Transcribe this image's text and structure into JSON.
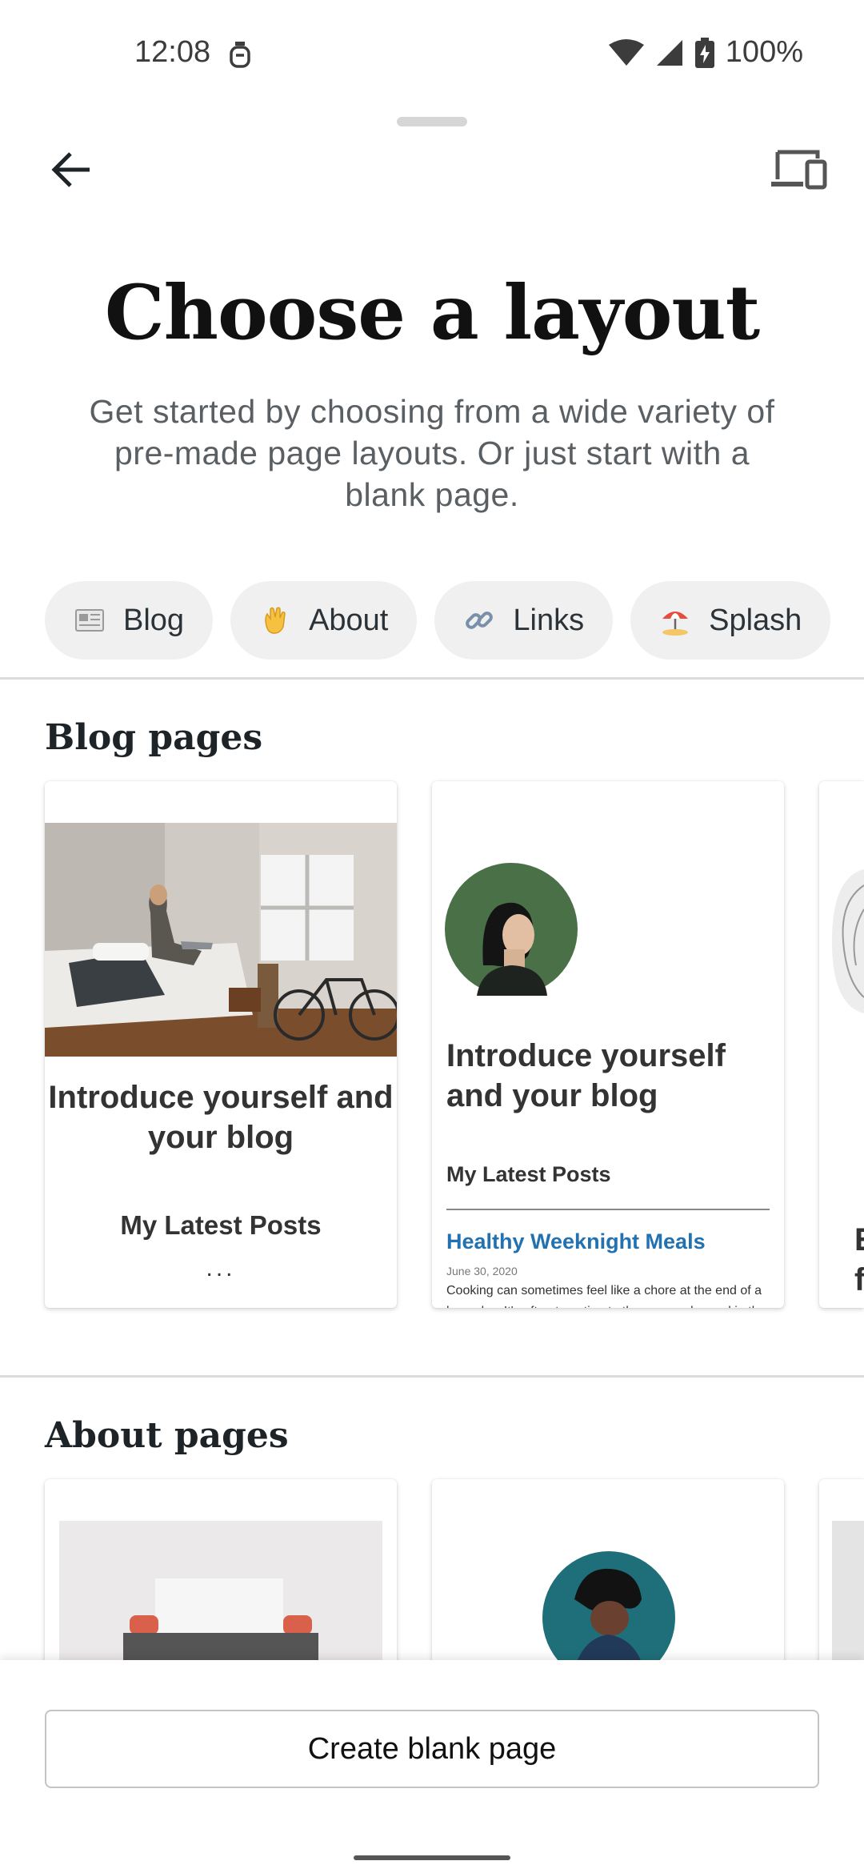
{
  "status_bar": {
    "time": "12:08",
    "battery": "100%"
  },
  "header": {
    "back_icon": "arrow-left-icon",
    "device_icon": "device-preview-icon"
  },
  "title": "Choose a layout",
  "subtitle": "Get started by choosing from a wide variety of pre-made page layouts. Or just start with a blank page.",
  "categories": [
    {
      "label": "Blog",
      "emoji": "newspaper"
    },
    {
      "label": "About",
      "emoji": "waving-hand"
    },
    {
      "label": "Links",
      "emoji": "link"
    },
    {
      "label": "Splash",
      "emoji": "beach-umbrella"
    }
  ],
  "sections": [
    {
      "title": "Blog pages",
      "cards": [
        {
          "heading": "Introduce yourself and your blog",
          "subheading": "My Latest Posts",
          "more": "..."
        },
        {
          "heading": "Introduce yourself and your blog",
          "subheading": "My Latest Posts",
          "post_title": "Healthy Weeknight Meals",
          "post_date": "June 30, 2020",
          "post_excerpt": "Cooking can sometimes feel like a chore at the end of a busy day. It's often tempting to throw a ready meal in the"
        },
        {
          "partial_text": "E f"
        }
      ]
    },
    {
      "title": "About pages"
    }
  ],
  "create_button": "Create blank page",
  "colors": {
    "accent_link": "#2271b1",
    "chip_bg": "#f0f0f0"
  }
}
